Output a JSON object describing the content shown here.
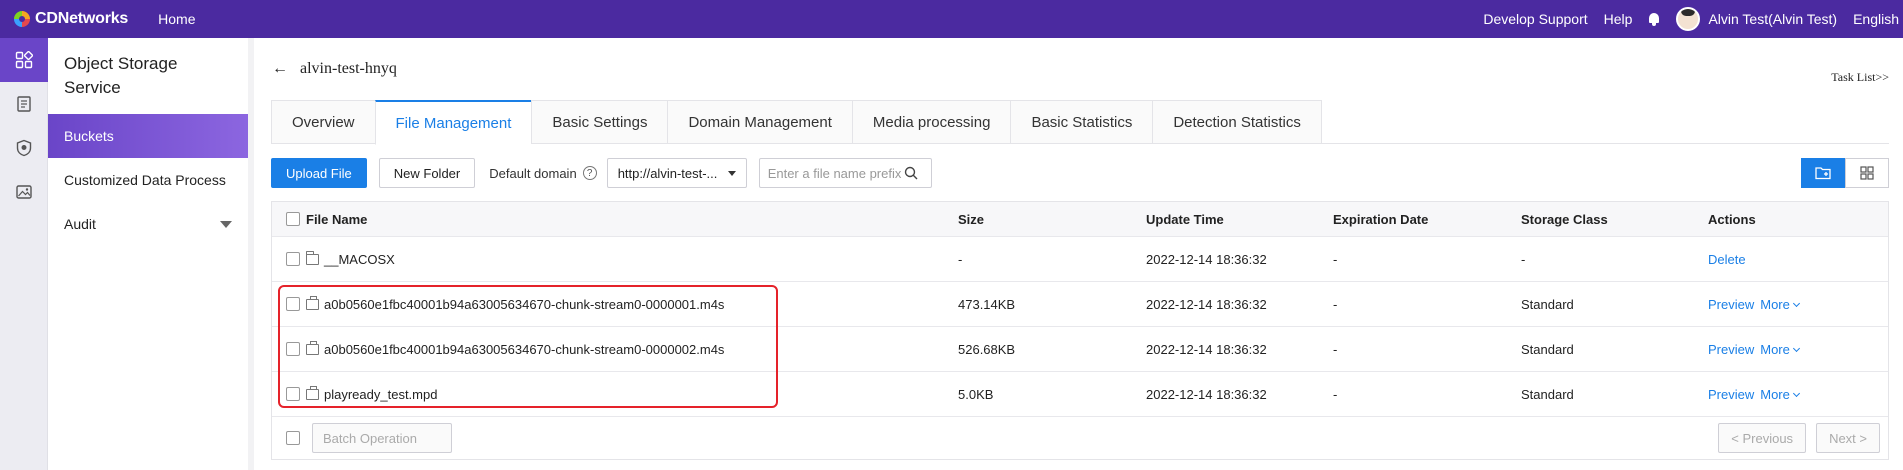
{
  "topbar": {
    "brand": "CDNetworks",
    "home": "Home",
    "develop_support": "Develop Support",
    "help": "Help",
    "user": "Alvin Test(Alvin Test)",
    "language": "English"
  },
  "sidebar": {
    "title": "Object Storage Service",
    "items": [
      {
        "label": "Buckets"
      },
      {
        "label": "Customized Data Process"
      },
      {
        "label": "Audit"
      }
    ]
  },
  "header": {
    "bucket_name": "alvin-test-hnyq",
    "task_list": "Task List>>"
  },
  "tabs": [
    {
      "label": "Overview"
    },
    {
      "label": "File Management"
    },
    {
      "label": "Basic Settings"
    },
    {
      "label": "Domain Management"
    },
    {
      "label": "Media processing"
    },
    {
      "label": "Basic Statistics"
    },
    {
      "label": "Detection Statistics"
    }
  ],
  "toolbar": {
    "upload": "Upload File",
    "new_folder": "New Folder",
    "default_domain_label": "Default domain",
    "domain_value": "http://alvin-test-...",
    "search_placeholder": "Enter a file name prefix"
  },
  "table": {
    "columns": [
      "File Name",
      "Size",
      "Update Time",
      "Expiration Date",
      "Storage Class",
      "Actions"
    ],
    "rows": [
      {
        "name": "__MACOSX",
        "type": "folder",
        "size": "-",
        "time": "2022-12-14 18:36:32",
        "expiration": "-",
        "class": "-",
        "action1": "Delete",
        "action2": ""
      },
      {
        "name": "a0b0560e1fbc40001b94a63005634670-chunk-stream0-0000001.m4s",
        "type": "file",
        "size": "473.14KB",
        "time": "2022-12-14 18:36:32",
        "expiration": "-",
        "class": "Standard",
        "action1": "Preview",
        "action2": "More"
      },
      {
        "name": "a0b0560e1fbc40001b94a63005634670-chunk-stream0-0000002.m4s",
        "type": "file",
        "size": "526.68KB",
        "time": "2022-12-14 18:36:32",
        "expiration": "-",
        "class": "Standard",
        "action1": "Preview",
        "action2": "More"
      },
      {
        "name": "playready_test.mpd",
        "type": "file",
        "size": "5.0KB",
        "time": "2022-12-14 18:36:32",
        "expiration": "-",
        "class": "Standard",
        "action1": "Preview",
        "action2": "More"
      }
    ]
  },
  "footer": {
    "batch_operation": "Batch Operation",
    "previous": "< Previous",
    "next": "Next >"
  },
  "colors": {
    "brand_purple": "#4b2aa0",
    "accent_blue": "#1a7fe6",
    "highlight_red": "#e5222a"
  }
}
